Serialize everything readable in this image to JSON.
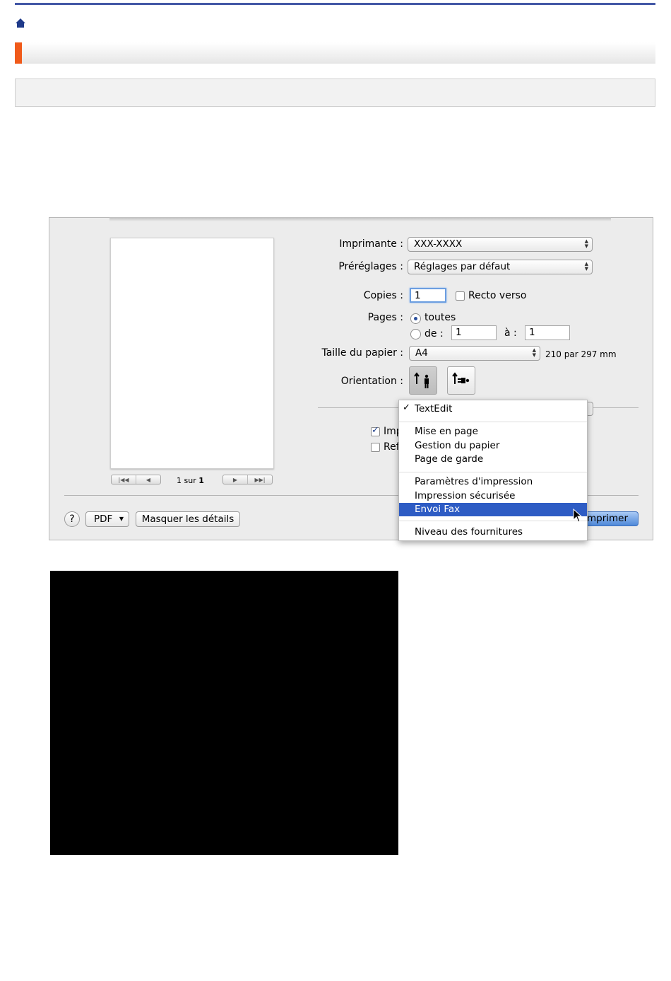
{
  "print_dialog": {
    "printer_label": "Imprimante :",
    "printer_value": "XXX-XXXX",
    "presets_label": "Préréglages :",
    "presets_value": "Réglages par défaut",
    "copies_label": "Copies :",
    "copies_value": "1",
    "duplex_label": "Recto verso",
    "pages_label": "Pages :",
    "pages_all": "toutes",
    "pages_from": "de :",
    "pages_from_value": "1",
    "pages_to": "à :",
    "pages_to_value": "1",
    "paper_size_label": "Taille du papier :",
    "paper_size_value": "A4",
    "paper_size_dims": "210 par 297 mm",
    "orientation_label": "Orientation :",
    "page_counter_pre": "1 sur ",
    "page_counter_total": "1",
    "hidden_check1_text": "Imp",
    "hidden_check2_text": "Ref",
    "help_label": "?",
    "pdf_label": "PDF",
    "hide_details_label": "Masquer les détails",
    "print_label": "mprimer"
  },
  "menu": {
    "checked_item": "TextEdit",
    "items": [
      "Mise en page",
      "Gestion du papier",
      "Page de garde",
      "Paramètres d'impression",
      "Impression sécurisée",
      "Envoi Fax",
      "Niveau des fournitures"
    ],
    "selected": "Envoi Fax"
  },
  "colors": {
    "accent_bar": "#4357a6",
    "title_marker": "#f05a1a",
    "menu_highlight": "#2e5cc4"
  },
  "icons": [
    "home-icon",
    "portrait-orientation-icon",
    "landscape-orientation-icon",
    "mouse-cursor-icon"
  ]
}
